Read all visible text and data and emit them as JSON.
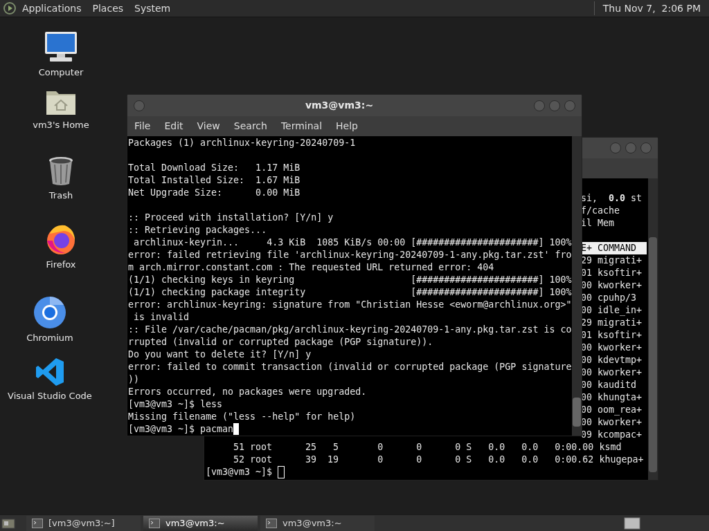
{
  "top_panel": {
    "menus": [
      "Applications",
      "Places",
      "System"
    ],
    "clock": "Thu Nov 7,  2:06 PM"
  },
  "desktop_icons": [
    {
      "label": "Computer",
      "kind": "computer"
    },
    {
      "label": "vm3's Home",
      "kind": "home"
    },
    {
      "label": "Trash",
      "kind": "trash"
    },
    {
      "label": "Firefox",
      "kind": "firefox"
    },
    {
      "label": "Chromium",
      "kind": "chromium"
    },
    {
      "label": "Visual Studio Code",
      "kind": "vscode"
    }
  ],
  "back_terminal": {
    "lines": [
      {
        "kind": "fragment",
        "text": "si,  **0.0** st",
        "highlighted": false
      },
      {
        "kind": "fragment",
        "text": "f/cache",
        "highlighted": false
      },
      {
        "kind": "fragment",
        "text": "il Mem",
        "highlighted": false
      },
      {
        "kind": "blank"
      },
      {
        "kind": "fragment",
        "text": "E+ COMMAND",
        "highlighted": true
      },
      {
        "kind": "fragment",
        "text": "29 migrati+",
        "highlighted": false
      },
      {
        "kind": "fragment",
        "text": "01 ksoftir+",
        "highlighted": false
      },
      {
        "kind": "fragment",
        "text": "00 kworker+",
        "highlighted": false
      },
      {
        "kind": "fragment",
        "text": "00 cpuhp/3",
        "highlighted": false
      },
      {
        "kind": "fragment",
        "text": "00 idle_in+",
        "highlighted": false
      },
      {
        "kind": "fragment",
        "text": "29 migrati+",
        "highlighted": false
      },
      {
        "kind": "fragment",
        "text": "01 ksoftir+",
        "highlighted": false
      },
      {
        "kind": "fragment",
        "text": "00 kworker+",
        "highlighted": false
      },
      {
        "kind": "fragment",
        "text": "00 kdevtmp+",
        "highlighted": false
      },
      {
        "kind": "fragment",
        "text": "00 kworker+",
        "highlighted": false
      },
      {
        "kind": "fragment",
        "text": "00 kauditd",
        "highlighted": false
      },
      {
        "kind": "fragment",
        "text": "00 khungta+",
        "highlighted": false
      },
      {
        "kind": "fragment",
        "text": "00 oom_rea+",
        "highlighted": false
      },
      {
        "kind": "fragment",
        "text": "00 kworker+",
        "highlighted": false
      },
      {
        "kind": "fragment",
        "text": "09 kcompac+",
        "highlighted": false
      },
      {
        "kind": "full",
        "text": "     51 root      25   5       0      0      0 S   0.0   0.0   0:00.00 ksmd"
      },
      {
        "kind": "full",
        "text": "     52 root      39  19       0      0      0 S   0.0   0.0   0:00.62 khugepa+"
      },
      {
        "kind": "prompt",
        "text": "[vm3@vm3 ~]$ "
      }
    ]
  },
  "front_terminal": {
    "title": "vm3@vm3:~",
    "menu": [
      "File",
      "Edit",
      "View",
      "Search",
      "Terminal",
      "Help"
    ],
    "lines": [
      {
        "kind": "text",
        "text": "Packages (1) archlinux-keyring-20240709-1"
      },
      {
        "kind": "blank"
      },
      {
        "kind": "text",
        "text": "Total Download Size:   1.17 MiB"
      },
      {
        "kind": "text",
        "text": "Total Installed Size:  1.67 MiB"
      },
      {
        "kind": "text",
        "text": "Net Upgrade Size:      0.00 MiB"
      },
      {
        "kind": "blank"
      },
      {
        "kind": "text",
        "text": ":: Proceed with installation? [Y/n] y"
      },
      {
        "kind": "text",
        "text": ":: Retrieving packages..."
      },
      {
        "kind": "text",
        "text": " archlinux-keyrin...     4.3 KiB  1085 KiB/s 00:00 [######################] 100%"
      },
      {
        "kind": "text",
        "text": "error: failed retrieving file 'archlinux-keyring-20240709-1-any.pkg.tar.zst' fro"
      },
      {
        "kind": "text",
        "text": "m arch.mirror.constant.com : The requested URL returned error: 404"
      },
      {
        "kind": "text",
        "text": "(1/1) checking keys in keyring                     [######################] 100%"
      },
      {
        "kind": "text",
        "text": "(1/1) checking package integrity                   [######################] 100%"
      },
      {
        "kind": "text",
        "text": "error: archlinux-keyring: signature from \"Christian Hesse <eworm@archlinux.org>\""
      },
      {
        "kind": "text",
        "text": " is invalid"
      },
      {
        "kind": "text",
        "text": ":: File /var/cache/pacman/pkg/archlinux-keyring-20240709-1-any.pkg.tar.zst is co"
      },
      {
        "kind": "text",
        "text": "rrupted (invalid or corrupted package (PGP signature))."
      },
      {
        "kind": "text",
        "text": "Do you want to delete it? [Y/n] y"
      },
      {
        "kind": "text",
        "text": "error: failed to commit transaction (invalid or corrupted package (PGP signature"
      },
      {
        "kind": "text",
        "text": "))"
      },
      {
        "kind": "text",
        "text": "Errors occurred, no packages were upgraded."
      },
      {
        "kind": "text",
        "text": "[vm3@vm3 ~]$ less"
      },
      {
        "kind": "text",
        "text": "Missing filename (\"less --help\" for help)"
      },
      {
        "kind": "prompt",
        "text": "[vm3@vm3 ~]$ pacman"
      }
    ]
  },
  "taskbar": {
    "buttons": [
      {
        "label": "[vm3@vm3:~]",
        "selected": false
      },
      {
        "label": "vm3@vm3:~",
        "selected": true
      },
      {
        "label": "vm3@vm3:~",
        "selected": false
      }
    ]
  }
}
